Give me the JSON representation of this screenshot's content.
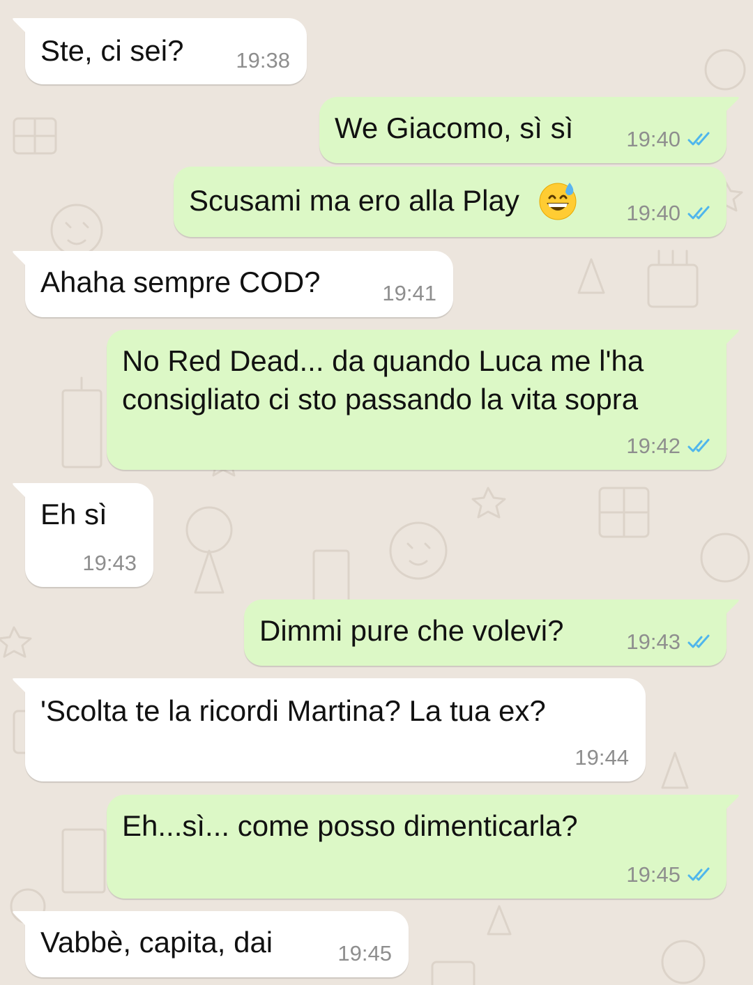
{
  "chat": {
    "messages": [
      {
        "direction": "incoming",
        "text": "Ste, ci sei?",
        "time": "19:38"
      },
      {
        "direction": "outgoing",
        "text": "We Giacomo, sì sì",
        "time": "19:40",
        "status": "read"
      },
      {
        "direction": "outgoing",
        "text": "Scusami ma ero alla Play",
        "emoji": "grinning-face-with-sweat",
        "time": "19:40",
        "status": "read"
      },
      {
        "direction": "incoming",
        "text": "Ahaha sempre COD?",
        "time": "19:41"
      },
      {
        "direction": "outgoing",
        "lines": [
          "No Red Dead... da quando Luca me l'ha",
          "consigliato ci sto passando la vita sopra"
        ],
        "time": "19:42",
        "status": "read"
      },
      {
        "direction": "incoming",
        "text": "Eh sì",
        "time": "19:43"
      },
      {
        "direction": "outgoing",
        "text": "Dimmi pure che volevi?",
        "time": "19:43",
        "status": "read"
      },
      {
        "direction": "incoming",
        "text": "'Scolta te la ricordi Martina? La tua ex?",
        "time": "19:44"
      },
      {
        "direction": "outgoing",
        "text": "Eh...sì... come posso dimenticarla?",
        "time": "19:45",
        "status": "read"
      },
      {
        "direction": "incoming",
        "text": "Vabbè, capita, dai",
        "time": "19:45"
      }
    ]
  },
  "colors": {
    "background": "#ECE5DD",
    "incoming_bubble": "#FFFFFF",
    "outgoing_bubble": "#DCF8C6",
    "read_ticks": "#4FB6EC",
    "timestamp": "#8E8E8E",
    "text": "#111111"
  }
}
